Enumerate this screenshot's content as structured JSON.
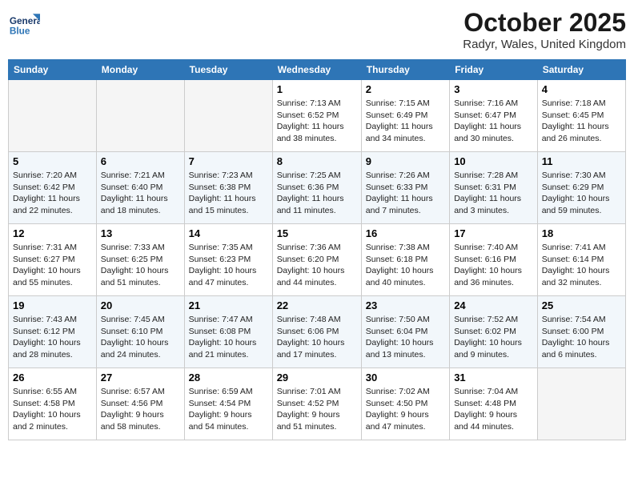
{
  "header": {
    "logo_line1": "General",
    "logo_line2": "Blue",
    "month": "October 2025",
    "location": "Radyr, Wales, United Kingdom"
  },
  "weekdays": [
    "Sunday",
    "Monday",
    "Tuesday",
    "Wednesday",
    "Thursday",
    "Friday",
    "Saturday"
  ],
  "weeks": [
    [
      {
        "day": "",
        "info": ""
      },
      {
        "day": "",
        "info": ""
      },
      {
        "day": "",
        "info": ""
      },
      {
        "day": "1",
        "info": "Sunrise: 7:13 AM\nSunset: 6:52 PM\nDaylight: 11 hours\nand 38 minutes."
      },
      {
        "day": "2",
        "info": "Sunrise: 7:15 AM\nSunset: 6:49 PM\nDaylight: 11 hours\nand 34 minutes."
      },
      {
        "day": "3",
        "info": "Sunrise: 7:16 AM\nSunset: 6:47 PM\nDaylight: 11 hours\nand 30 minutes."
      },
      {
        "day": "4",
        "info": "Sunrise: 7:18 AM\nSunset: 6:45 PM\nDaylight: 11 hours\nand 26 minutes."
      }
    ],
    [
      {
        "day": "5",
        "info": "Sunrise: 7:20 AM\nSunset: 6:42 PM\nDaylight: 11 hours\nand 22 minutes."
      },
      {
        "day": "6",
        "info": "Sunrise: 7:21 AM\nSunset: 6:40 PM\nDaylight: 11 hours\nand 18 minutes."
      },
      {
        "day": "7",
        "info": "Sunrise: 7:23 AM\nSunset: 6:38 PM\nDaylight: 11 hours\nand 15 minutes."
      },
      {
        "day": "8",
        "info": "Sunrise: 7:25 AM\nSunset: 6:36 PM\nDaylight: 11 hours\nand 11 minutes."
      },
      {
        "day": "9",
        "info": "Sunrise: 7:26 AM\nSunset: 6:33 PM\nDaylight: 11 hours\nand 7 minutes."
      },
      {
        "day": "10",
        "info": "Sunrise: 7:28 AM\nSunset: 6:31 PM\nDaylight: 11 hours\nand 3 minutes."
      },
      {
        "day": "11",
        "info": "Sunrise: 7:30 AM\nSunset: 6:29 PM\nDaylight: 10 hours\nand 59 minutes."
      }
    ],
    [
      {
        "day": "12",
        "info": "Sunrise: 7:31 AM\nSunset: 6:27 PM\nDaylight: 10 hours\nand 55 minutes."
      },
      {
        "day": "13",
        "info": "Sunrise: 7:33 AM\nSunset: 6:25 PM\nDaylight: 10 hours\nand 51 minutes."
      },
      {
        "day": "14",
        "info": "Sunrise: 7:35 AM\nSunset: 6:23 PM\nDaylight: 10 hours\nand 47 minutes."
      },
      {
        "day": "15",
        "info": "Sunrise: 7:36 AM\nSunset: 6:20 PM\nDaylight: 10 hours\nand 44 minutes."
      },
      {
        "day": "16",
        "info": "Sunrise: 7:38 AM\nSunset: 6:18 PM\nDaylight: 10 hours\nand 40 minutes."
      },
      {
        "day": "17",
        "info": "Sunrise: 7:40 AM\nSunset: 6:16 PM\nDaylight: 10 hours\nand 36 minutes."
      },
      {
        "day": "18",
        "info": "Sunrise: 7:41 AM\nSunset: 6:14 PM\nDaylight: 10 hours\nand 32 minutes."
      }
    ],
    [
      {
        "day": "19",
        "info": "Sunrise: 7:43 AM\nSunset: 6:12 PM\nDaylight: 10 hours\nand 28 minutes."
      },
      {
        "day": "20",
        "info": "Sunrise: 7:45 AM\nSunset: 6:10 PM\nDaylight: 10 hours\nand 24 minutes."
      },
      {
        "day": "21",
        "info": "Sunrise: 7:47 AM\nSunset: 6:08 PM\nDaylight: 10 hours\nand 21 minutes."
      },
      {
        "day": "22",
        "info": "Sunrise: 7:48 AM\nSunset: 6:06 PM\nDaylight: 10 hours\nand 17 minutes."
      },
      {
        "day": "23",
        "info": "Sunrise: 7:50 AM\nSunset: 6:04 PM\nDaylight: 10 hours\nand 13 minutes."
      },
      {
        "day": "24",
        "info": "Sunrise: 7:52 AM\nSunset: 6:02 PM\nDaylight: 10 hours\nand 9 minutes."
      },
      {
        "day": "25",
        "info": "Sunrise: 7:54 AM\nSunset: 6:00 PM\nDaylight: 10 hours\nand 6 minutes."
      }
    ],
    [
      {
        "day": "26",
        "info": "Sunrise: 6:55 AM\nSunset: 4:58 PM\nDaylight: 10 hours\nand 2 minutes."
      },
      {
        "day": "27",
        "info": "Sunrise: 6:57 AM\nSunset: 4:56 PM\nDaylight: 9 hours\nand 58 minutes."
      },
      {
        "day": "28",
        "info": "Sunrise: 6:59 AM\nSunset: 4:54 PM\nDaylight: 9 hours\nand 54 minutes."
      },
      {
        "day": "29",
        "info": "Sunrise: 7:01 AM\nSunset: 4:52 PM\nDaylight: 9 hours\nand 51 minutes."
      },
      {
        "day": "30",
        "info": "Sunrise: 7:02 AM\nSunset: 4:50 PM\nDaylight: 9 hours\nand 47 minutes."
      },
      {
        "day": "31",
        "info": "Sunrise: 7:04 AM\nSunset: 4:48 PM\nDaylight: 9 hours\nand 44 minutes."
      },
      {
        "day": "",
        "info": ""
      }
    ]
  ]
}
